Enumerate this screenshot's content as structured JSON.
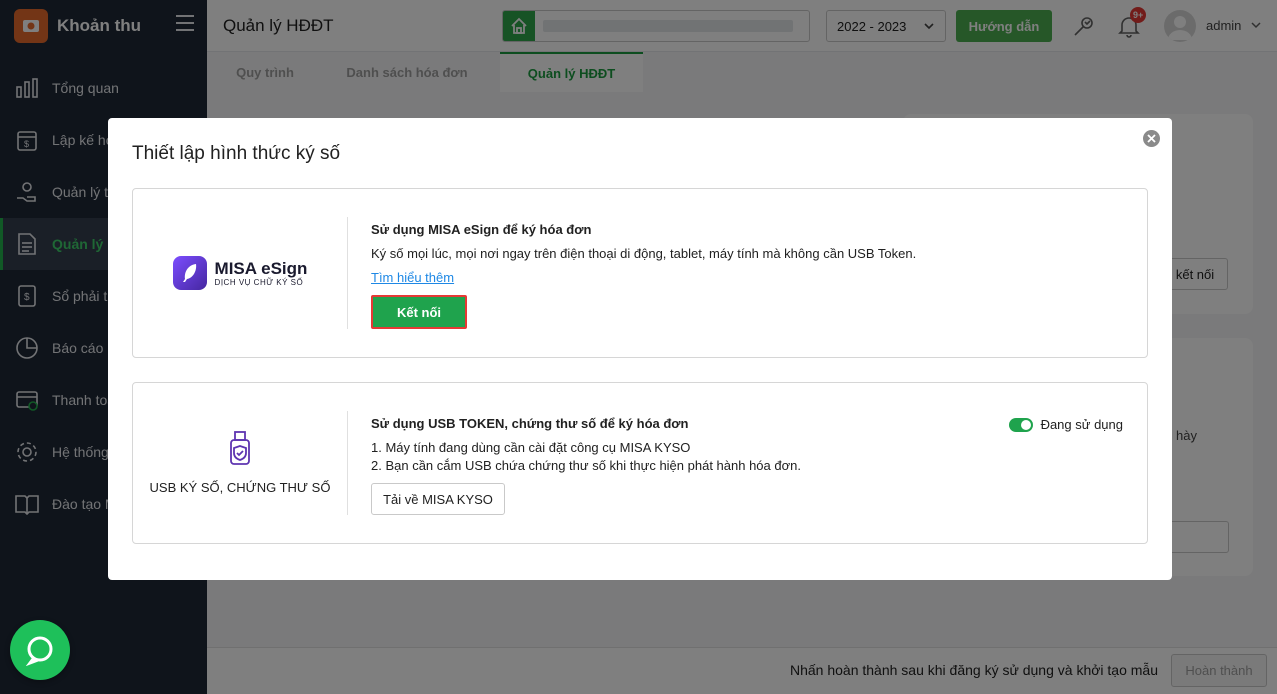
{
  "app": {
    "name": "Khoản thu"
  },
  "sidebar": {
    "items": [
      {
        "label": "Tổng quan",
        "icon": "chart-bar-icon"
      },
      {
        "label": "Lập kế ho",
        "icon": "calendar-dollar-icon"
      },
      {
        "label": "Quản lý t",
        "icon": "hand-coin-icon"
      },
      {
        "label": "Quản lý H",
        "icon": "document-icon",
        "active": true
      },
      {
        "label": "Sổ phải th",
        "icon": "ledger-dollar-icon"
      },
      {
        "label": "Báo cáo",
        "icon": "pie-chart-icon"
      },
      {
        "label": "Thanh toá",
        "icon": "payment-card-icon"
      },
      {
        "label": "Hệ thống",
        "icon": "gear-icon"
      },
      {
        "label": "Đào tạo M",
        "icon": "open-book-icon"
      }
    ]
  },
  "header": {
    "title": "Quản lý HĐĐT",
    "fiscal_year": "2022 - 2023",
    "guide_label": "Hướng dẫn",
    "notification_count": "9+",
    "username": "admin"
  },
  "tabs": [
    {
      "label": "Quy trình"
    },
    {
      "label": "Danh sách hóa đơn"
    },
    {
      "label": "Quản lý HĐĐT",
      "active": true
    }
  ],
  "background": {
    "connect_label": "kết nối",
    "partial_text": "hày"
  },
  "footer": {
    "hint": "Nhấn hoàn thành sau khi đăng ký sử dụng và khởi tạo mẫu",
    "finish_label": "Hoàn thành"
  },
  "modal": {
    "title": "Thiết lập hình thức ký số",
    "esign": {
      "brand_name": "MISA eSign",
      "brand_sub": "DỊCH VỤ CHỮ KÝ SỐ",
      "title": "Sử dụng MISA eSign để ký hóa đơn",
      "description": "Ký số mọi lúc, mọi nơi ngay trên điện thoại di động, tablet, máy tính mà không cần USB Token.",
      "learn_more": "Tìm hiểu thêm",
      "connect_label": "Kết nối"
    },
    "usb": {
      "label": "USB KÝ SỐ, CHỨNG THƯ SỐ",
      "title": "Sử dụng USB TOKEN, chứng thư số để ký hóa đơn",
      "step1": "1. Máy tính đang dùng cần cài đặt công cụ MISA KYSO",
      "step2": "2. Bạn cần cắm USB chứa chứng thư số khi thực hiện phát hành hóa đơn.",
      "download_label": "Tải về MISA KYSO",
      "status_label": "Đang sử dụng",
      "status_on": true
    }
  },
  "colors": {
    "brand_green": "#1fa34d",
    "sidebar_bg": "#1f2937",
    "highlight_border": "#e53935"
  }
}
